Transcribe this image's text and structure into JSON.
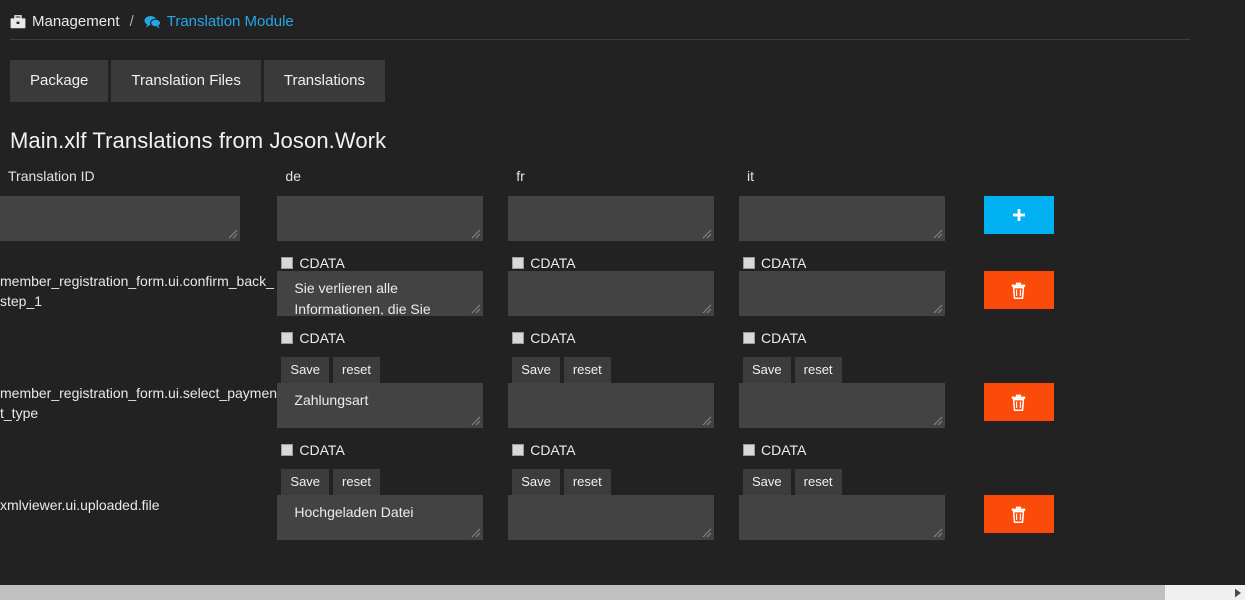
{
  "breadcrumb": {
    "root_label": "Management",
    "root_icon": "briefcase-icon",
    "separator": "/",
    "current_label": "Translation Module",
    "current_icon": "comments-icon",
    "link_color": "#25a6e8"
  },
  "tabs": [
    {
      "label": "Package",
      "name": "tab-package"
    },
    {
      "label": "Translation Files",
      "name": "tab-translation-files"
    },
    {
      "label": "Translations",
      "name": "tab-translations"
    }
  ],
  "page_title": "Main.xlf Translations from Joson.Work",
  "table": {
    "headers": [
      "Translation ID",
      "de",
      "fr",
      "it"
    ],
    "cdata_label": "CDATA",
    "save_label": "Save",
    "reset_label": "reset",
    "add_label": "+",
    "add_icon": "plus-icon",
    "delete_icon": "trash-icon",
    "add_button_color": "#00b0f0",
    "delete_button_color": "#fb4b0b",
    "new_row": {
      "id_value": "",
      "id_placeholder": "",
      "de_value": "",
      "fr_value": "",
      "it_value": ""
    },
    "rows": [
      {
        "id": "member_registration_form.ui.confirm_back_step_1",
        "de": "Sie verlieren alle Informationen, die Sie",
        "fr": "",
        "it": "",
        "de_cdata": false,
        "fr_cdata": false,
        "it_cdata": false
      },
      {
        "id": "member_registration_form.ui.select_payment_type",
        "de": "Zahlungsart",
        "fr": "",
        "it": "",
        "de_cdata": false,
        "fr_cdata": false,
        "it_cdata": false
      },
      {
        "id": "xmlviewer.ui.uploaded.file",
        "de": "Hochgeladen Datei",
        "fr": "",
        "it": "",
        "de_cdata": false,
        "fr_cdata": false,
        "it_cdata": false
      }
    ]
  },
  "scrollbar": {
    "orientation": "horizontal",
    "right_arrow_icon": "arrow-right-icon"
  }
}
